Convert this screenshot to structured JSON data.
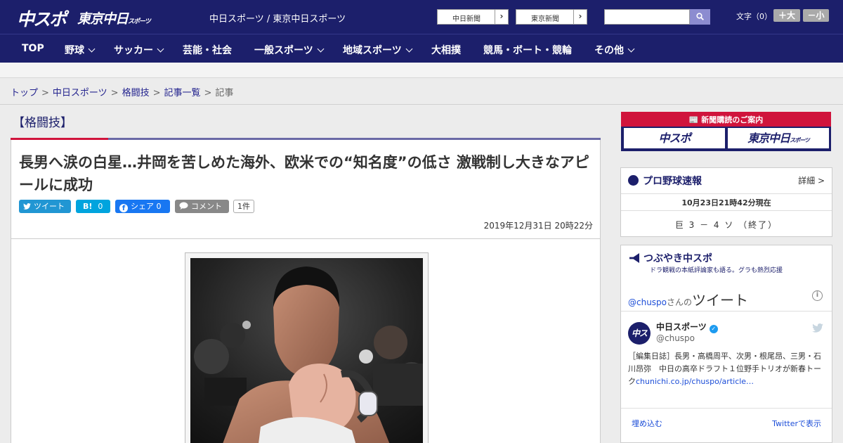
{
  "header": {
    "logo_chuspo": "中スポ",
    "logo_tokyo": "東京中日",
    "logo_tokyo_small": "スポーツ",
    "site_title": "中日スポーツ / 東京中日スポーツ",
    "paper_links": [
      "中日新聞",
      "東京新聞"
    ],
    "search": {
      "placeholder": ""
    },
    "font_label": "文字（0）",
    "font_increase": "＋大",
    "font_decrease": "－小"
  },
  "nav": {
    "items": [
      {
        "label": "TOP",
        "dropdown": false
      },
      {
        "label": "野球",
        "dropdown": true
      },
      {
        "label": "サッカー",
        "dropdown": true
      },
      {
        "label": "芸能・社会",
        "dropdown": false
      },
      {
        "label": "一般スポーツ",
        "dropdown": true
      },
      {
        "label": "地域スポーツ",
        "dropdown": true
      },
      {
        "label": "大相撲",
        "dropdown": false
      },
      {
        "label": "競馬・ボート・競輪",
        "dropdown": false
      },
      {
        "label": "その他",
        "dropdown": true
      }
    ]
  },
  "breadcrumb": {
    "items": [
      "トップ",
      "中日スポーツ",
      "格闘技",
      "記事一覧"
    ],
    "current": "記事",
    "sep": ">"
  },
  "article": {
    "category": "【格闘技】",
    "headline": "長男へ涙の白星…井岡を苦しめた海外、欧米での“知名度”の低さ 激戦制し大きなアピールに成功",
    "share": {
      "twitter": "ツイート",
      "hatena_icon": "B!",
      "hatena_count": "0",
      "facebook": "シェア",
      "facebook_count": "0",
      "comment": "コメント",
      "comment_count": "1件"
    },
    "date": "2019年12月31日 20時22分"
  },
  "sidebar": {
    "subscribe": {
      "title": "新聞購読のご案内",
      "chuspo": "中スポ",
      "tokyo": "東京中日",
      "tokyo_small": "スポーツ"
    },
    "baseball": {
      "title": "プロ野球速報",
      "detail": "詳細 >",
      "time": "10月23日21時42分現在",
      "score": "巨 3 － 4 ソ （終了）"
    },
    "twitter": {
      "title": "つぶやき中スポ",
      "subtitle": "ドラ観戦の本紙評論家も語る。グラも熱烈応援",
      "handle": "@chuspo",
      "handle_suffix": "さんの",
      "tweet_word": "ツイート",
      "name": "中日スポーツ",
      "user": "@chuspo",
      "avatar_text": "中スポ",
      "text": "［編集日誌］長男・高橋周平、次男・根尾昂、三男・石川昂弥　中日の高卒ドラフト１位野手トリオが新春トーク",
      "link": "chunichi.co.jp/chuspo/article…",
      "embed": "埋め込む",
      "view": "Twitterで表示"
    }
  },
  "colors": {
    "brand_navy": "#1c1f6b",
    "accent_red": "#d0143c",
    "twitter_blue": "#2196d3",
    "hatena_blue": "#00a4de",
    "facebook_blue": "#1877f2"
  }
}
